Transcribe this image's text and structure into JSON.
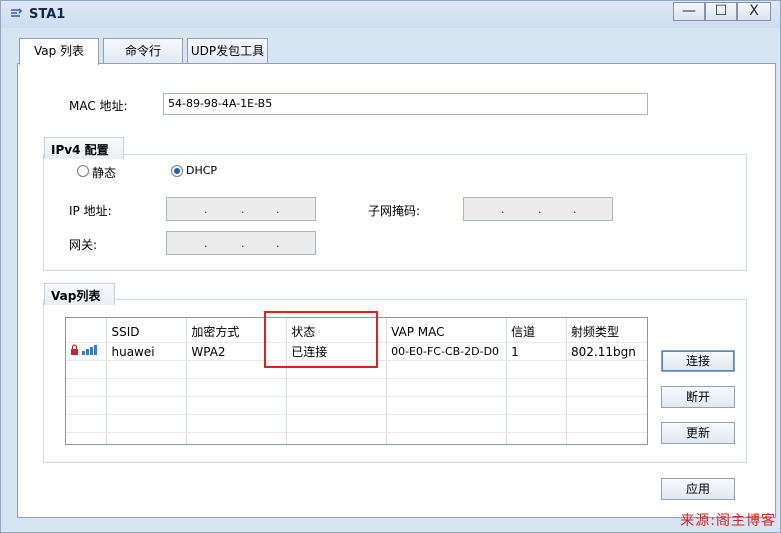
{
  "window": {
    "title": "STA1",
    "minimize": "—",
    "maximize": "☐",
    "close": "X"
  },
  "tabs": [
    {
      "label": "Vap 列表"
    },
    {
      "label": "命令行"
    },
    {
      "label": "UDP发包工具"
    }
  ],
  "mac": {
    "label": "MAC 地址:",
    "value": "54-89-98-4A-1E-B5"
  },
  "ipv4": {
    "group_title": "IPv4 配置",
    "static_label": "静态",
    "dhcp_label": "DHCP",
    "selected": "DHCP",
    "ip_label": "IP 地址:",
    "mask_label": "子网掩码:",
    "gateway_label": "网关:",
    "dot": "."
  },
  "vap": {
    "group_title": "Vap列表",
    "columns": [
      "",
      "SSID",
      "加密方式",
      "状态",
      "VAP MAC",
      "信道",
      "射频类型"
    ],
    "rows": [
      {
        "ssid": "huawei",
        "encryption": "WPA2",
        "status": "已连接",
        "vap_mac": "00-E0-FC-CB-2D-D0",
        "channel": "1",
        "radio": "802.11bgn",
        "locked": true
      }
    ],
    "buttons": {
      "connect": "连接",
      "disconnect": "断开",
      "refresh": "更新"
    }
  },
  "apply_label": "应用",
  "watermark": "来源:阁主博客",
  "colors": {
    "highlight": "#e02020",
    "radio_selected": "#1a5fb4",
    "watermark": "#d42424"
  }
}
